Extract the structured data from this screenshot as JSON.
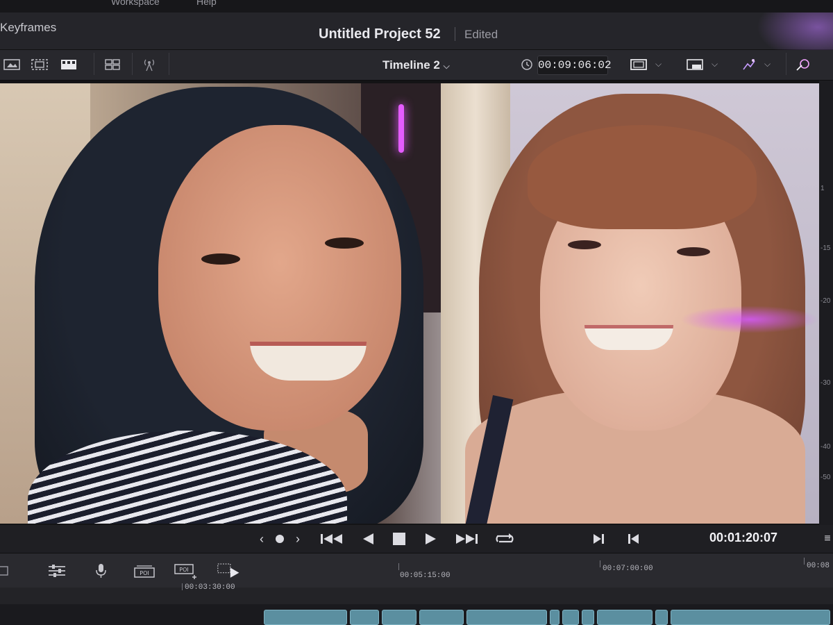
{
  "menu": {
    "items": [
      "Workspace",
      "Help"
    ]
  },
  "header": {
    "panel_label": "Keyframes",
    "project_title": "Untitled Project 52",
    "status": "Edited"
  },
  "toolbar": {
    "timeline_name": "Timeline 2",
    "timecode": "00:09:06:02"
  },
  "viewer": {
    "scale_ticks": [
      "1",
      "-15",
      "-20",
      "-30",
      "-40",
      "-50"
    ]
  },
  "transport": {
    "current_timecode": "00:01:20:07"
  },
  "timeline": {
    "ruler_upper": [
      "00:05:15:00",
      "00:07:00:00",
      "00:08"
    ],
    "ruler_lower": [
      "00:03:30:00"
    ]
  },
  "colors": {
    "accent_purple": "#e45cff",
    "clip_teal": "#5b8fa0",
    "panel_bg": "#28282d"
  },
  "icons": [
    "viewer-mode-icon",
    "clip-view-icon",
    "film-strip-icon",
    "multiview-icon",
    "broadcast-icon",
    "timecode-clock-icon",
    "fit-icon",
    "hq-icon",
    "sparkle-icon",
    "magic-mask-icon",
    "in-point-icon",
    "out-point-icon",
    "rewind-icon",
    "play-reverse-icon",
    "stop-icon",
    "play-icon",
    "fast-forward-icon",
    "loop-icon",
    "mixer-icon",
    "mic-icon",
    "poi-icon",
    "poi-add-icon",
    "track-play-icon"
  ]
}
